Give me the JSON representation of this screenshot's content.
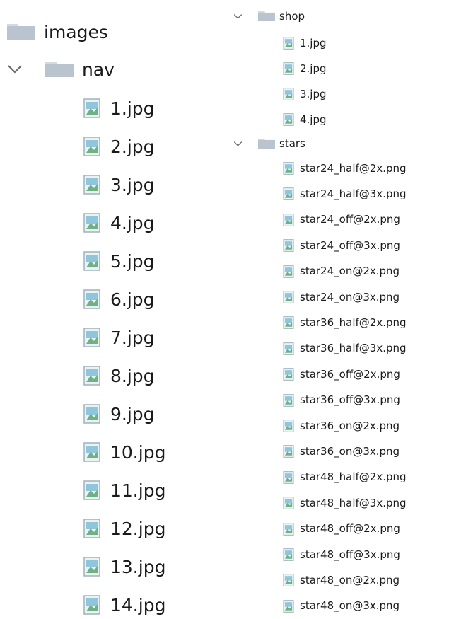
{
  "colors": {
    "folder_body": "#b9c4cf",
    "folder_tab": "#d2dae2",
    "file_bg": "#eaf2f4",
    "file_border": "#9fb2bf",
    "file_sky": "#8fc6db",
    "file_land": "#6fb184",
    "chevron": "#6b6b6b",
    "text": "#1a1a1a"
  },
  "left": {
    "root": {
      "label": "images"
    },
    "nav": {
      "label": "nav",
      "expanded": true,
      "files": [
        "1.jpg",
        "2.jpg",
        "3.jpg",
        "4.jpg",
        "5.jpg",
        "6.jpg",
        "7.jpg",
        "8.jpg",
        "9.jpg",
        "10.jpg",
        "11.jpg",
        "12.jpg",
        "13.jpg",
        "14.jpg"
      ]
    }
  },
  "right": {
    "shop": {
      "label": "shop",
      "expanded": true,
      "files": [
        "1.jpg",
        "2.jpg",
        "3.jpg",
        "4.jpg"
      ]
    },
    "stars": {
      "label": "stars",
      "expanded": true,
      "files": [
        "star24_half@2x.png",
        "star24_half@3x.png",
        "star24_off@2x.png",
        "star24_off@3x.png",
        "star24_on@2x.png",
        "star24_on@3x.png",
        "star36_half@2x.png",
        "star36_half@3x.png",
        "star36_off@2x.png",
        "star36_off@3x.png",
        "star36_on@2x.png",
        "star36_on@3x.png",
        "star48_half@2x.png",
        "star48_half@3x.png",
        "star48_off@2x.png",
        "star48_off@3x.png",
        "star48_on@2x.png",
        "star48_on@3x.png"
      ]
    }
  }
}
